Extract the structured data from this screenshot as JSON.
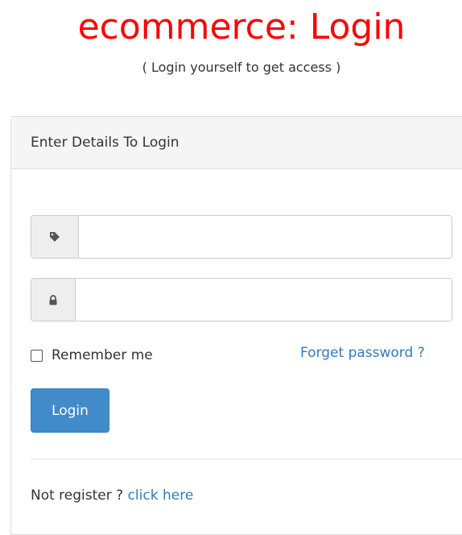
{
  "header": {
    "title": "ecommerce: Login",
    "subtitle": "( Login yourself to get access )"
  },
  "panel": {
    "heading": "Enter Details To Login"
  },
  "form": {
    "username": {
      "icon": "tag-icon",
      "value": "",
      "placeholder": ""
    },
    "password": {
      "icon": "lock-icon",
      "value": "",
      "placeholder": ""
    },
    "remember_label": "Remember me",
    "remember_checked": false,
    "forget_label": "Forget password ?",
    "login_label": "Login"
  },
  "footer": {
    "prompt": "Not register ? ",
    "link_label": "click here"
  },
  "colors": {
    "title": "#ff0000",
    "link": "#337ab7",
    "primary_button": "#428bca",
    "panel_heading_bg": "#f5f5f5",
    "addon_bg": "#eeeeee"
  }
}
